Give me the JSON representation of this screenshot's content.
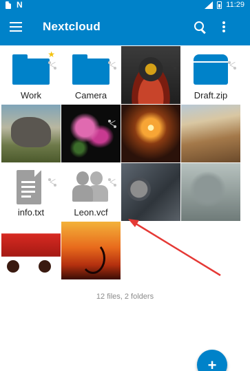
{
  "status_bar": {
    "time": "11:29"
  },
  "app_bar": {
    "title": "Nextcloud"
  },
  "files": [
    {
      "kind": "folder",
      "name": "Work",
      "starred": true
    },
    {
      "kind": "folder",
      "name": "Camera"
    },
    {
      "kind": "image",
      "name": "",
      "thumb": "bee"
    },
    {
      "kind": "zip",
      "name": "Draft.zip"
    },
    {
      "kind": "image",
      "name": "",
      "thumb": "elephant"
    },
    {
      "kind": "image",
      "name": "",
      "thumb": "flower"
    },
    {
      "kind": "image",
      "name": "",
      "thumb": "candle"
    },
    {
      "kind": "image",
      "name": "",
      "thumb": "valley"
    },
    {
      "kind": "text",
      "name": "info.txt"
    },
    {
      "kind": "contact",
      "name": "Leon.vcf"
    },
    {
      "kind": "image",
      "name": "",
      "thumb": "watch"
    },
    {
      "kind": "image",
      "name": "",
      "thumb": "seal"
    },
    {
      "kind": "image",
      "name": "",
      "thumb": "firetruck"
    },
    {
      "kind": "image",
      "name": "",
      "thumb": "sunset"
    }
  ],
  "footer": {
    "summary": "12 files, 2 folders"
  },
  "fab": {
    "label": "+"
  },
  "colors": {
    "brand": "#0082c9",
    "star": "#f4c20d",
    "annotation_arrow": "#e53935"
  },
  "icons": {
    "menu": "menu-icon",
    "search": "search-icon",
    "overflow": "overflow-icon",
    "share": "share-icon",
    "star": "star-icon"
  }
}
